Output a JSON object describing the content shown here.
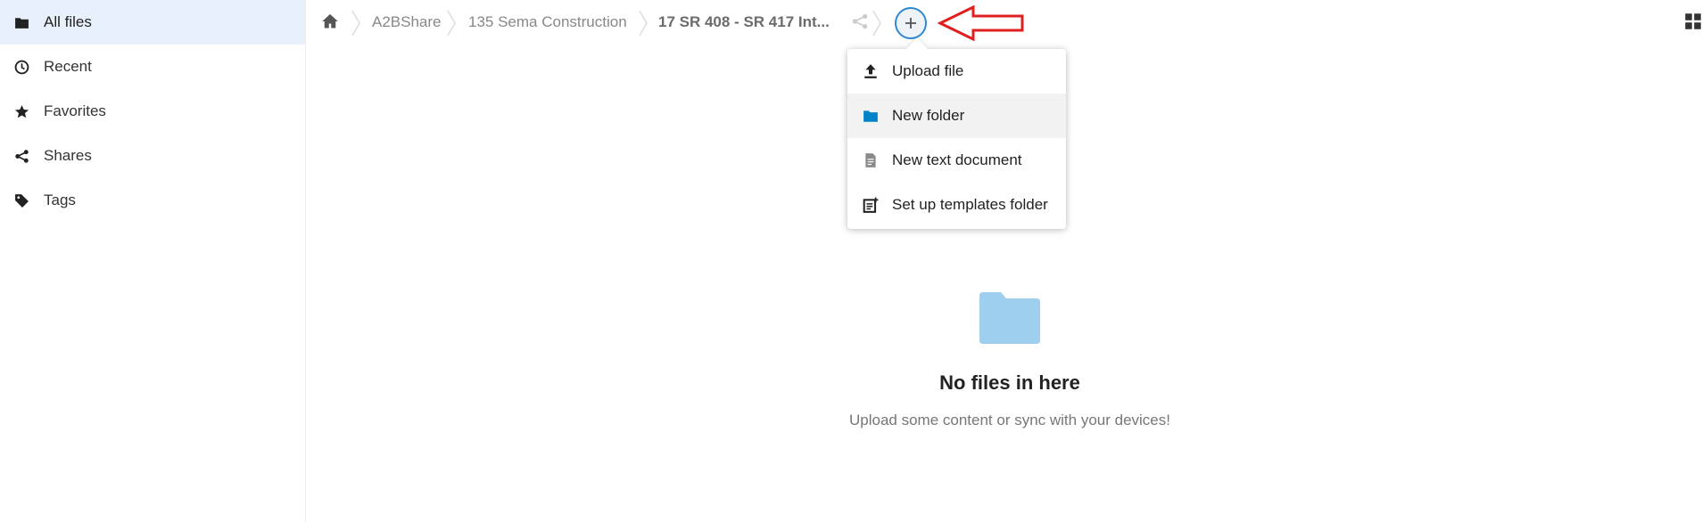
{
  "sidebar": {
    "items": [
      {
        "label": "All files",
        "icon": "folder-icon",
        "active": true
      },
      {
        "label": "Recent",
        "icon": "clock-icon"
      },
      {
        "label": "Favorites",
        "icon": "star-icon"
      },
      {
        "label": "Shares",
        "icon": "share-icon"
      },
      {
        "label": "Tags",
        "icon": "tag-icon"
      }
    ]
  },
  "breadcrumb": {
    "items": [
      "A2BShare",
      "135 Sema Construction",
      "17 SR 408 - SR 417 Int..."
    ]
  },
  "new_menu": {
    "items": [
      {
        "label": "Upload file",
        "icon": "upload-icon"
      },
      {
        "label": "New folder",
        "icon": "folder-icon"
      },
      {
        "label": "New text document",
        "icon": "document-icon"
      },
      {
        "label": "Set up templates folder",
        "icon": "template-icon"
      }
    ]
  },
  "empty": {
    "title": "No files in here",
    "subtitle": "Upload some content or sync with your devices!"
  },
  "colors": {
    "accent": "#2f88d0",
    "sidebar_active": "#e8f1fb",
    "folder": "#9fcfee",
    "annotation_arrow": "#e02020"
  }
}
